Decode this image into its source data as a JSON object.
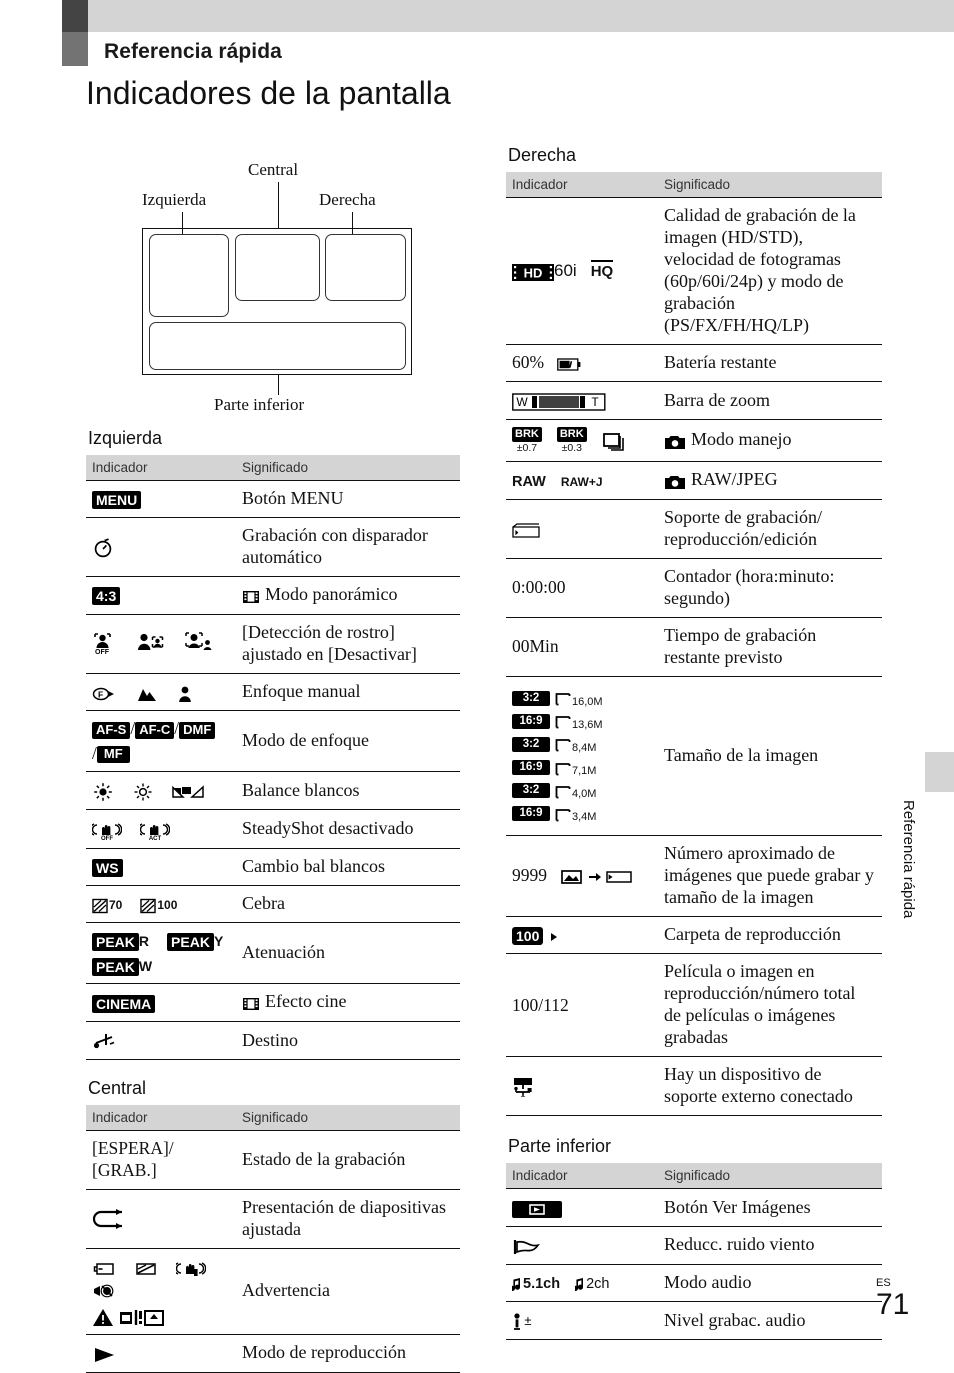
{
  "running_head": "Referencia rápida",
  "page_title": "Indicadores de la pantalla",
  "side_tab_label": "Referencia rápida",
  "page": {
    "lang": "ES",
    "number": "71"
  },
  "diagram": {
    "label_top_center": "Central",
    "label_top_left": "Izquierda",
    "label_top_right": "Derecha",
    "label_bottom": "Parte inferior"
  },
  "columns": {
    "indicator": "Indicador",
    "meaning": "Significado"
  },
  "sections": {
    "izquierda": {
      "title": "Izquierda",
      "rows": [
        {
          "icon": "menu-button-badge",
          "icon_text": "MENU",
          "meaning": "Botón MENU"
        },
        {
          "icon": "self-timer-icon",
          "icon_text": "",
          "meaning": "Grabación con disparador automático"
        },
        {
          "icon": "aspect-4-3-badge",
          "icon_text": "4:3",
          "meaning": "Modo panorámico",
          "meaning_icon": "film-strip-icon"
        },
        {
          "icon": "face-detection-icons",
          "icon_text": "",
          "meaning": "[Detección de rostro] ajustado en [Desactivar]"
        },
        {
          "icon": "manual-focus-icons",
          "icon_text": "",
          "meaning": "Enfoque manual"
        },
        {
          "icon": "focus-mode-badges",
          "icon_text": "AF-S / AF-C / DMF / MF",
          "meaning": "Modo de enfoque"
        },
        {
          "icon": "white-balance-icons",
          "icon_text": "",
          "meaning": "Balance blancos"
        },
        {
          "icon": "steadyshot-off-icons",
          "icon_text": "",
          "meaning": "SteadyShot desactivado"
        },
        {
          "icon": "ws-badge",
          "icon_text": "WS",
          "meaning": "Cambio bal blancos"
        },
        {
          "icon": "zebra-icons",
          "icon_text": "70  100",
          "meaning": "Cebra"
        },
        {
          "icon": "peaking-badges",
          "icon_text": "PEAK R  PEAK Y  PEAK W",
          "meaning": "Atenuación"
        },
        {
          "icon": "cinema-badge",
          "icon_text": "CINEMA",
          "meaning": "Efecto cine",
          "meaning_icon": "film-strip-icon"
        },
        {
          "icon": "destination-airplane-icon",
          "icon_text": "",
          "meaning": "Destino"
        }
      ]
    },
    "central": {
      "title": "Central",
      "rows": [
        {
          "icon": "recording-state-text",
          "icon_text": "[ESPERA]/ [GRAB.]",
          "meaning": "Estado de la grabación"
        },
        {
          "icon": "slideshow-loop-icon",
          "icon_text": "",
          "meaning": "Presentación de diapositivas ajustada"
        },
        {
          "icon": "warning-icons",
          "icon_text": "",
          "meaning": "Advertencia"
        },
        {
          "icon": "playback-mode-icon",
          "icon_text": "",
          "meaning": "Modo de reproducción"
        }
      ]
    },
    "derecha": {
      "title": "Derecha",
      "rows": [
        {
          "icon": "hd-60i-hq-badge",
          "icon_text": "HD 60i HQ",
          "meaning": "Calidad de grabación de la imagen (HD/STD), velocidad de fotogramas (60p/60i/24p) y modo de grabación (PS/FX/FH/HQ/LP)"
        },
        {
          "icon": "battery-icon",
          "icon_text": "60%",
          "meaning": "Batería restante"
        },
        {
          "icon": "zoom-bar-icon",
          "icon_text": "W  T",
          "meaning": "Barra de zoom"
        },
        {
          "icon": "drive-mode-icons",
          "icon_text": "BRK ±0.7  BRK ±0.3",
          "meaning": "Modo manejo",
          "meaning_icon": "photo-camera-icon"
        },
        {
          "icon": "raw-jpeg-icons",
          "icon_text": "RAW  RAW+J",
          "meaning": "RAW/JPEG",
          "meaning_icon": "photo-camera-icon"
        },
        {
          "icon": "media-card-icon",
          "icon_text": "",
          "meaning": "Soporte de grabación/ reproducción/edición"
        },
        {
          "icon": "counter-text",
          "icon_text": "0:00:00",
          "meaning": "Contador (hora:minuto: segundo)"
        },
        {
          "icon": "remaining-time-text",
          "icon_text": "00Min",
          "meaning": "Tiempo de grabación restante previsto"
        },
        {
          "icon": "image-size-badges",
          "icon_text": "3:2 16,0M / 16:9 13,6M / 3:2 8,4M / 16:9 7,1M / 3:2 4,0M / 16:9 3,4M",
          "meaning": "Tamaño de la imagen"
        },
        {
          "icon": "recordable-images-icon",
          "icon_text": "9999",
          "meaning": "Número aproximado de imágenes que puede grabar y tamaño de la imagen"
        },
        {
          "icon": "playback-folder-badge",
          "icon_text": "100",
          "meaning": "Carpeta de reproducción"
        },
        {
          "icon": "playback-count-text",
          "icon_text": "100/112",
          "meaning": "Película o imagen en reproducción/número total de películas o imágenes grabadas"
        },
        {
          "icon": "external-media-usb-icon",
          "icon_text": "",
          "meaning": "Hay un dispositivo de soporte externo conectado"
        }
      ]
    },
    "parte_inferior": {
      "title": "Parte inferior",
      "rows": [
        {
          "icon": "view-images-button-badge",
          "icon_text": "",
          "meaning": "Botón Ver Imágenes"
        },
        {
          "icon": "wind-noise-reduction-icon",
          "icon_text": "",
          "meaning": "Reducc. ruido viento"
        },
        {
          "icon": "audio-mode-icons",
          "icon_text": "5.1ch  2ch",
          "meaning": "Modo audio"
        },
        {
          "icon": "audio-rec-level-icon",
          "icon_text": "",
          "meaning": "Nivel grabac. audio"
        }
      ]
    }
  },
  "image_sizes": [
    {
      "ratio": "3:2",
      "mp": "16,0M"
    },
    {
      "ratio": "16:9",
      "mp": "13,6M"
    },
    {
      "ratio": "3:2",
      "mp": "8,4M"
    },
    {
      "ratio": "16:9",
      "mp": "7,1M"
    },
    {
      "ratio": "3:2",
      "mp": "4,0M"
    },
    {
      "ratio": "16:9",
      "mp": "3,4M"
    }
  ],
  "badges": {
    "menu": "MENU",
    "aspect43": "4:3",
    "afs": "AF-S",
    "afc": "AF-C",
    "dmf": "DMF",
    "mf": "MF",
    "ws": "WS",
    "peak": "PEAK",
    "peak_r": "R",
    "peak_y": "Y",
    "peak_w": "W",
    "cinema": "CINEMA",
    "hd": "HD",
    "hd_rate": "60i",
    "hq": "HQ",
    "brk": "BRK",
    "brk_1": "±0.7",
    "brk_2": "±0.3",
    "raw": "RAW",
    "rawj": "RAW+J",
    "zoom_w": "W",
    "zoom_t": "T",
    "folder": "100",
    "battery_pct": "60%",
    "counter": "0:00:00",
    "remaining": "00Min",
    "shots": "9999",
    "playcount": "100/112",
    "zebra_70": "70",
    "zebra_100": "100",
    "audio_51": "5.1ch",
    "audio_2": "2ch",
    "standby_rec": "[ESPERA]/",
    "standby_rec2": "[GRAB.]",
    "slash": "/"
  },
  "colors": {
    "header_grey": "#d4d4d4",
    "tab_dark": "#444444",
    "tab_mid": "#737373",
    "ink": "#111111"
  }
}
